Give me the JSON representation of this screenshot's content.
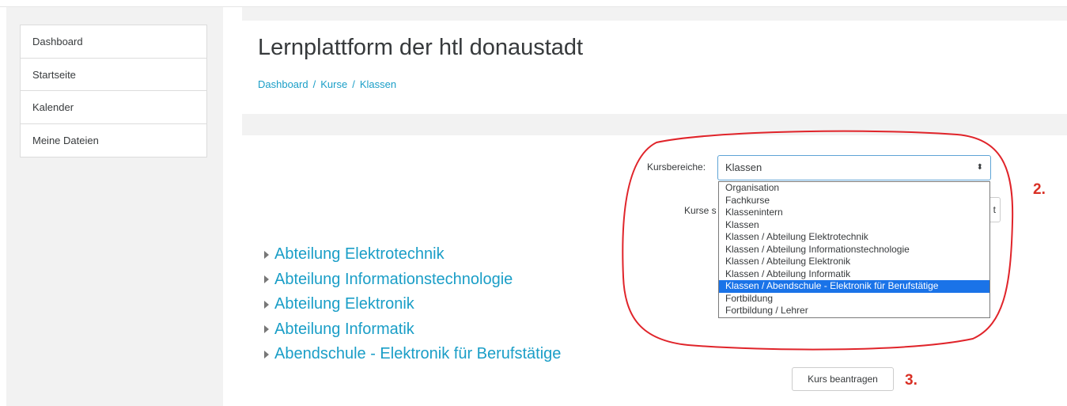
{
  "nav": {
    "items": [
      {
        "label": "Dashboard"
      },
      {
        "label": "Startseite"
      },
      {
        "label": "Kalender"
      },
      {
        "label": "Meine Dateien"
      }
    ]
  },
  "header": {
    "title": "Lernplattform der htl donaustadt",
    "breadcrumb": [
      "Dashboard",
      "Kurse",
      "Klassen"
    ],
    "breadcrumb_sep": "/"
  },
  "categories": [
    {
      "label": "Abteilung Elektrotechnik"
    },
    {
      "label": "Abteilung Informationstechnologie"
    },
    {
      "label": "Abteilung Elektronik"
    },
    {
      "label": "Abteilung Informatik"
    },
    {
      "label": "Abendschule - Elektronik für Berufstätige"
    }
  ],
  "course_select": {
    "label": "Kursbereiche:",
    "selected": "Klassen",
    "arrow": "⬍",
    "options": [
      {
        "label": "Organisation",
        "selected": false
      },
      {
        "label": "Fachkurse",
        "selected": false
      },
      {
        "label": "Klassenintern",
        "selected": false
      },
      {
        "label": "Klassen",
        "selected": false
      },
      {
        "label": "Klassen / Abteilung Elektrotechnik",
        "selected": false
      },
      {
        "label": "Klassen / Abteilung Informationstechnologie",
        "selected": false
      },
      {
        "label": "Klassen / Abteilung Elektronik",
        "selected": false
      },
      {
        "label": "Klassen / Abteilung Informatik",
        "selected": false
      },
      {
        "label": "Klassen / Abendschule - Elektronik für Berufstätige",
        "selected": true
      },
      {
        "label": "Fortbildung",
        "selected": false
      },
      {
        "label": "Fortbildung / Lehrer",
        "selected": false
      }
    ]
  },
  "search": {
    "label_partial": "Kurse s",
    "button_partial": "t"
  },
  "request_button": {
    "label": "Kurs beantragen"
  },
  "annotations": {
    "step2": "2.",
    "step3": "3.",
    "color": "#d93025"
  },
  "colors": {
    "link": "#1a9ec7",
    "selection": "#1a73e8"
  }
}
